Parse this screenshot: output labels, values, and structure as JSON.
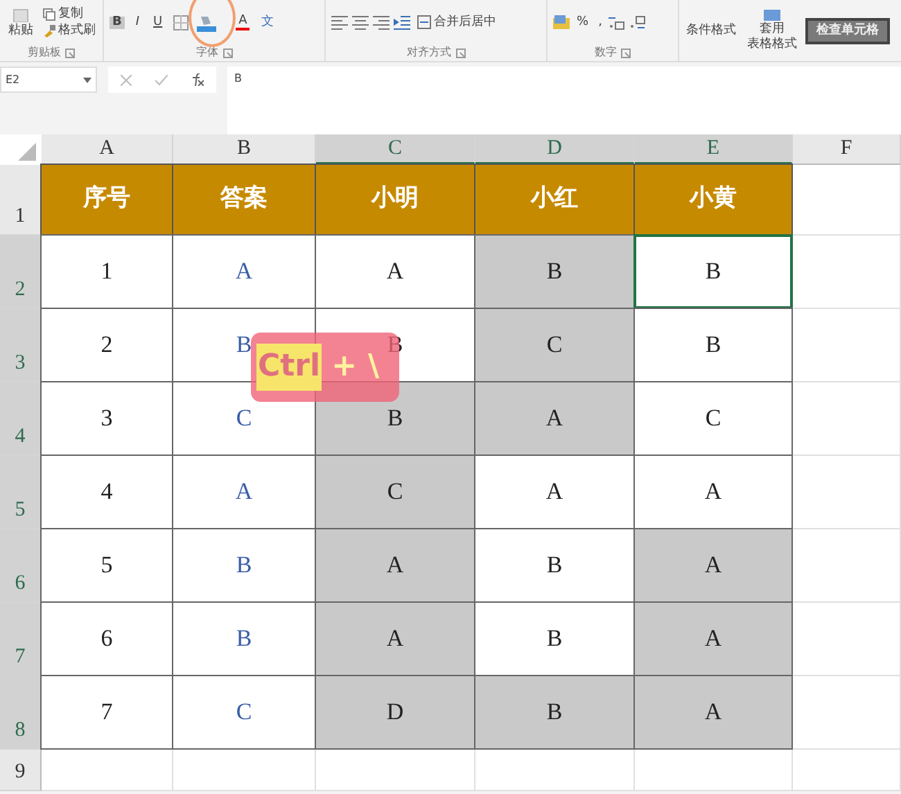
{
  "ribbon": {
    "clipboard": {
      "paste": "粘贴",
      "copy": "复制",
      "format_painter": "格式刷",
      "group_label": "剪贴板"
    },
    "font": {
      "bold": "B",
      "italic": "I",
      "underline": "U",
      "font_color": "A",
      "phonetic": "文",
      "group_label": "字体"
    },
    "alignment": {
      "merge": "合并后居中",
      "group_label": "对齐方式"
    },
    "number": {
      "percent": "%",
      "comma": ",",
      "group_label": "数字"
    },
    "styles": {
      "conditional": "条件格式",
      "table_format_1": "套用",
      "table_format_2": "表格格式",
      "cell_style": "检查单元格"
    }
  },
  "formula_bar": {
    "name_box": "E2",
    "formula": "B"
  },
  "columns": [
    {
      "label": "A",
      "selected": false
    },
    {
      "label": "B",
      "selected": false
    },
    {
      "label": "C",
      "selected": true
    },
    {
      "label": "D",
      "selected": true
    },
    {
      "label": "E",
      "selected": true
    },
    {
      "label": "F",
      "selected": false
    }
  ],
  "rows": [
    {
      "label": "1",
      "selected": false,
      "kind": "header",
      "cells": [
        {
          "text": "序号"
        },
        {
          "text": "答案"
        },
        {
          "text": "小明"
        },
        {
          "text": "小红"
        },
        {
          "text": "小黄"
        }
      ]
    },
    {
      "label": "2",
      "selected": true,
      "kind": "data",
      "cells": [
        {
          "text": "1",
          "shaded": false
        },
        {
          "text": "A",
          "shaded": false
        },
        {
          "text": "A",
          "shaded": false
        },
        {
          "text": "B",
          "shaded": true
        },
        {
          "text": "B",
          "shaded": false,
          "active": true
        }
      ]
    },
    {
      "label": "3",
      "selected": true,
      "kind": "data",
      "cells": [
        {
          "text": "2",
          "shaded": false
        },
        {
          "text": "B",
          "shaded": false
        },
        {
          "text": "B",
          "shaded": false
        },
        {
          "text": "C",
          "shaded": true
        },
        {
          "text": "B",
          "shaded": false
        }
      ]
    },
    {
      "label": "4",
      "selected": true,
      "kind": "data",
      "cells": [
        {
          "text": "3",
          "shaded": false
        },
        {
          "text": "C",
          "shaded": false
        },
        {
          "text": "B",
          "shaded": true
        },
        {
          "text": "A",
          "shaded": true
        },
        {
          "text": "C",
          "shaded": false
        }
      ]
    },
    {
      "label": "5",
      "selected": true,
      "kind": "data",
      "cells": [
        {
          "text": "4",
          "shaded": false
        },
        {
          "text": "A",
          "shaded": false
        },
        {
          "text": "C",
          "shaded": true
        },
        {
          "text": "A",
          "shaded": false
        },
        {
          "text": "A",
          "shaded": false
        }
      ]
    },
    {
      "label": "6",
      "selected": true,
      "kind": "data",
      "cells": [
        {
          "text": "5",
          "shaded": false
        },
        {
          "text": "B",
          "shaded": false
        },
        {
          "text": "A",
          "shaded": true
        },
        {
          "text": "B",
          "shaded": false
        },
        {
          "text": "A",
          "shaded": true
        }
      ]
    },
    {
      "label": "7",
      "selected": true,
      "kind": "data",
      "cells": [
        {
          "text": "6",
          "shaded": false
        },
        {
          "text": "B",
          "shaded": false
        },
        {
          "text": "A",
          "shaded": true
        },
        {
          "text": "B",
          "shaded": false
        },
        {
          "text": "A",
          "shaded": true
        }
      ]
    },
    {
      "label": "8",
      "selected": true,
      "kind": "data",
      "cells": [
        {
          "text": "7",
          "shaded": false
        },
        {
          "text": "C",
          "shaded": false
        },
        {
          "text": "D",
          "shaded": true
        },
        {
          "text": "B",
          "shaded": true
        },
        {
          "text": "A",
          "shaded": true
        }
      ]
    },
    {
      "label": "9",
      "selected": false,
      "kind": "empty",
      "cells": []
    }
  ],
  "key_overlay": {
    "keys": [
      {
        "text": "Ctrl",
        "highlighted": true
      },
      {
        "text": "+",
        "highlighted": false
      },
      {
        "text": "\\",
        "highlighted": false
      }
    ]
  }
}
